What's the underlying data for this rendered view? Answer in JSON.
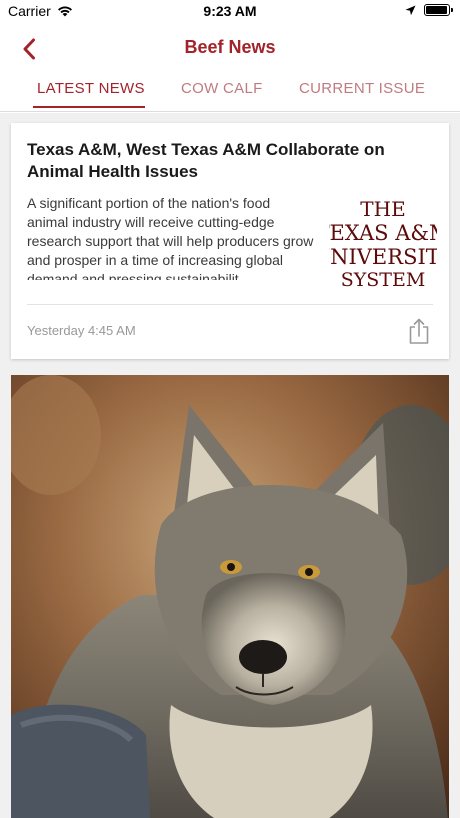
{
  "status_bar": {
    "carrier": "Carrier",
    "time": "9:23 AM",
    "battery_level": 0.95
  },
  "nav": {
    "title": "Beef News",
    "back_icon": "chevron-left-icon"
  },
  "tabs": [
    {
      "label": "LATEST NEWS",
      "active": true
    },
    {
      "label": "COW CALF",
      "active": false
    },
    {
      "label": "CURRENT ISSUE",
      "active": false
    }
  ],
  "articles": [
    {
      "title": "Texas A&M, West Texas A&M Collaborate on Animal Health Issues",
      "summary": "A significant portion of the nation's food animal industry will receive cutting-edge research support that will help producers grow and prosper in a time of increasing global demand and pressing sustainabilit...",
      "timestamp": "Yesterday 4:45 AM",
      "thumbnail": {
        "line1": "THE",
        "line2": "TEXAS A&M",
        "line3": "UNIVERSITY",
        "line4": "SYSTEM"
      },
      "share_icon": "share-icon"
    }
  ],
  "colors": {
    "accent": "#a3232b",
    "tab_inactive": "#c07b7f",
    "feed_background": "#f0f0f0",
    "muted_text": "#999999"
  }
}
